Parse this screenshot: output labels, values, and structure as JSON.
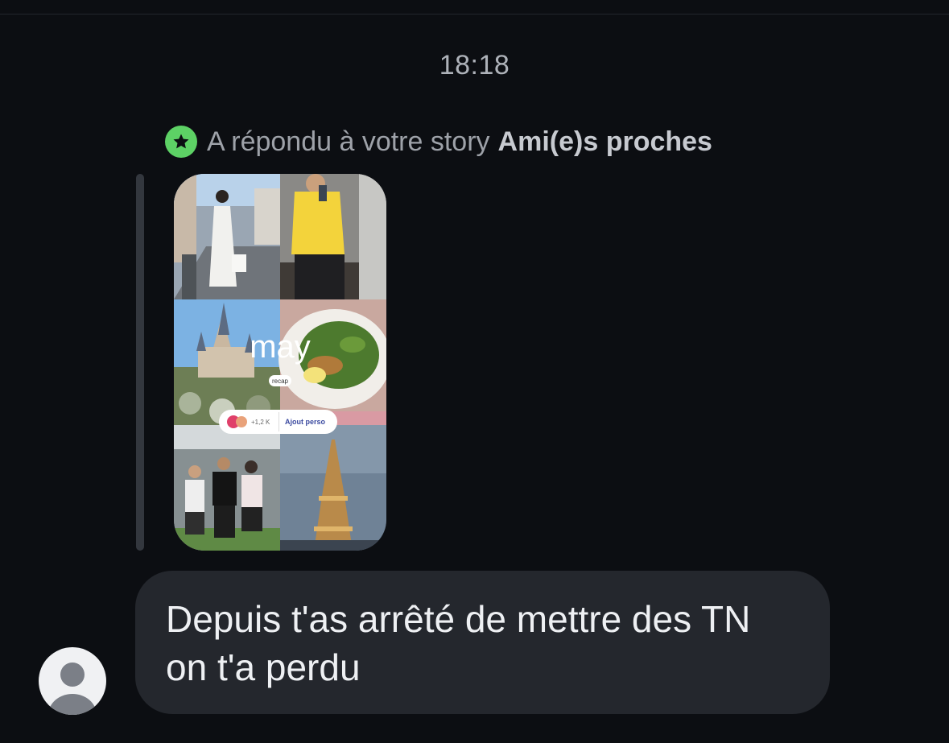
{
  "conversation": {
    "timestamp": "18:18",
    "reply_note": {
      "icon": "star-icon",
      "text": "A répondu à votre story",
      "story_audience": "Ami(e)s proches",
      "badge_color": "#5dd165"
    },
    "story": {
      "overlay_title": "may",
      "recap_label": "recap",
      "reactions_count": "+1,2 K",
      "add_yours_label": "Ajout perso"
    },
    "message": {
      "text": "Depuis t'as arrêté de mettre des TN\non t'a perdu"
    },
    "sender": {
      "avatar": "default-avatar-icon"
    }
  }
}
